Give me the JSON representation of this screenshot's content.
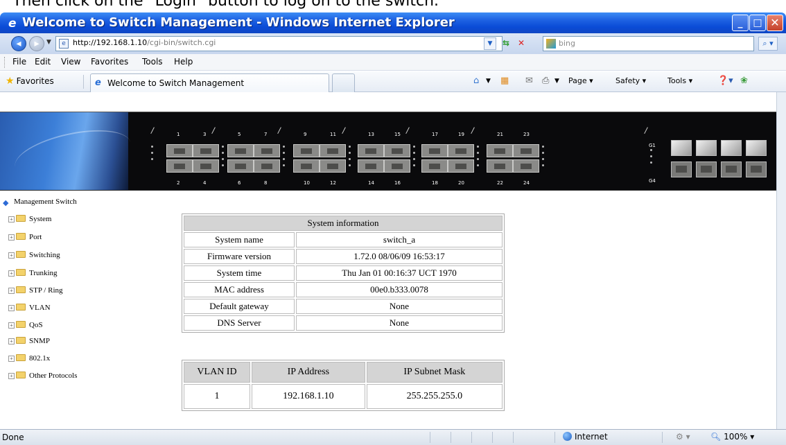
{
  "caption": "Then click on the \"Login\" button to log on to the switch.",
  "window": {
    "title": "Welcome to Switch Management - Windows Internet Explorer",
    "minimize_glyph": "_",
    "maximize_glyph": "□",
    "close_glyph": "✕"
  },
  "address_bar": {
    "url_host": "http://192.168.1.10",
    "url_path": "/cgi-bin/switch.cgi",
    "search_placeholder": "bing"
  },
  "menu": [
    "File",
    "Edit",
    "View",
    "Favorites",
    "Tools",
    "Help"
  ],
  "favorites_bar": {
    "favorites_label": "Favorites",
    "tab_label": "Welcome to Switch Management",
    "commands": [
      "Page ▾",
      "Safety ▾",
      "Tools ▾"
    ]
  },
  "switch_panel": {
    "port_numbers_top": [
      "1",
      "3",
      "5",
      "7",
      "9",
      "11",
      "13",
      "15",
      "17",
      "19",
      "21",
      "23"
    ],
    "port_numbers_bottom": [
      "2",
      "4",
      "6",
      "8",
      "10",
      "12",
      "14",
      "16",
      "18",
      "20",
      "22",
      "24"
    ],
    "sfp_labels": [
      "G1",
      "G4"
    ]
  },
  "tree": {
    "root": "Management Switch",
    "items": [
      "System",
      "Port",
      "Switching",
      "Trunking",
      "STP / Ring",
      "VLAN",
      "QoS",
      "SNMP",
      "802.1x",
      "Other Protocols"
    ]
  },
  "system_info": {
    "header": "System information",
    "rows": [
      {
        "label": "System name",
        "value": "switch_a"
      },
      {
        "label": "Firmware version",
        "value": "1.72.0 08/06/09 16:53:17"
      },
      {
        "label": "System time",
        "value": "Thu Jan 01 00:16:37 UCT 1970"
      },
      {
        "label": "MAC address",
        "value": "00e0.b333.0078"
      },
      {
        "label": "Default gateway",
        "value": "None"
      },
      {
        "label": "DNS Server",
        "value": "None"
      }
    ]
  },
  "vlan_table": {
    "headers": [
      "VLAN ID",
      "IP Address",
      "IP Subnet Mask"
    ],
    "rows": [
      [
        "1",
        "192.168.1.10",
        "255.255.255.0"
      ]
    ]
  },
  "status_bar": {
    "status": "Done",
    "zone": "Internet",
    "zoom": "100%"
  },
  "colors": {
    "titlebar": "#0a4bd6",
    "table_header": "#d4d4d4",
    "banner": "#0a0a0c"
  }
}
